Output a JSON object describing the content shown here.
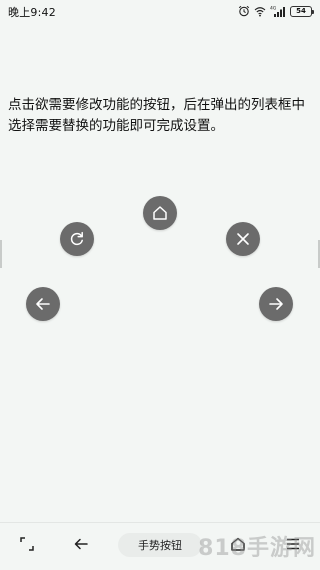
{
  "status_bar": {
    "time": "晚上9:42",
    "signal_label": "4G",
    "battery": "54"
  },
  "instruction": "点击欲需要修改功能的按钮，后在弹出的列表框中选择需要替换的功能即可完成设置。",
  "gesture_buttons": [
    {
      "name": "home",
      "icon": "home-icon"
    },
    {
      "name": "refresh",
      "icon": "refresh-icon"
    },
    {
      "name": "close",
      "icon": "close-icon"
    },
    {
      "name": "back",
      "icon": "arrow-left-icon"
    },
    {
      "name": "forward",
      "icon": "arrow-right-icon"
    }
  ],
  "nav_bar": {
    "center_label": "手势按钮",
    "icons": [
      "screenshot-corner-icon",
      "back-arrow-icon",
      "home-outline-icon",
      "menu-icon"
    ]
  },
  "watermark": "818手游网",
  "colors": {
    "background": "#f3f6f4",
    "button": "#6b6b6b",
    "icon": "#ffffff"
  }
}
